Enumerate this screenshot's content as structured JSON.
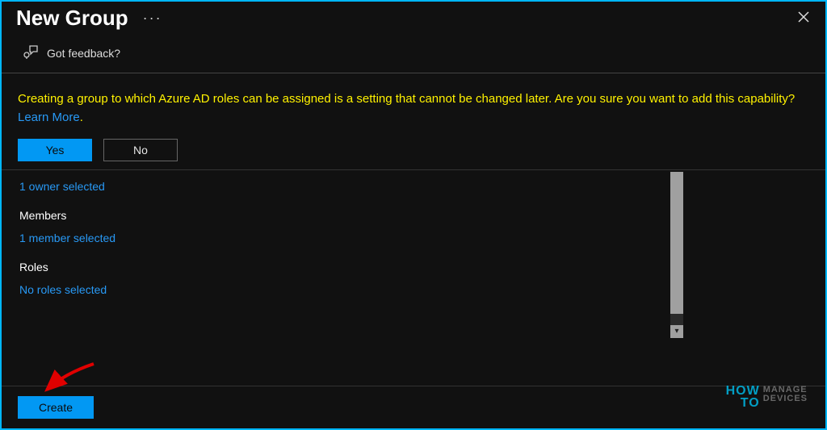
{
  "header": {
    "title": "New Group",
    "more_menu": "···"
  },
  "feedback": {
    "label": "Got feedback?"
  },
  "warning": {
    "text": "Creating a group to which Azure AD roles can be assigned is a setting that cannot be changed later. Are you sure you want to add this capability? ",
    "learn_more": "Learn More",
    "period": ".",
    "yes": "Yes",
    "no": "No"
  },
  "owners": {
    "selected_link": "1 owner selected"
  },
  "members": {
    "label": "Members",
    "selected_link": "1 member selected"
  },
  "roles": {
    "label": "Roles",
    "selected_link": "No roles selected"
  },
  "footer": {
    "create": "Create"
  },
  "watermark": {
    "how": "HOW",
    "to": "TO",
    "r1": "MANAGE",
    "r2": "DEVICES"
  }
}
